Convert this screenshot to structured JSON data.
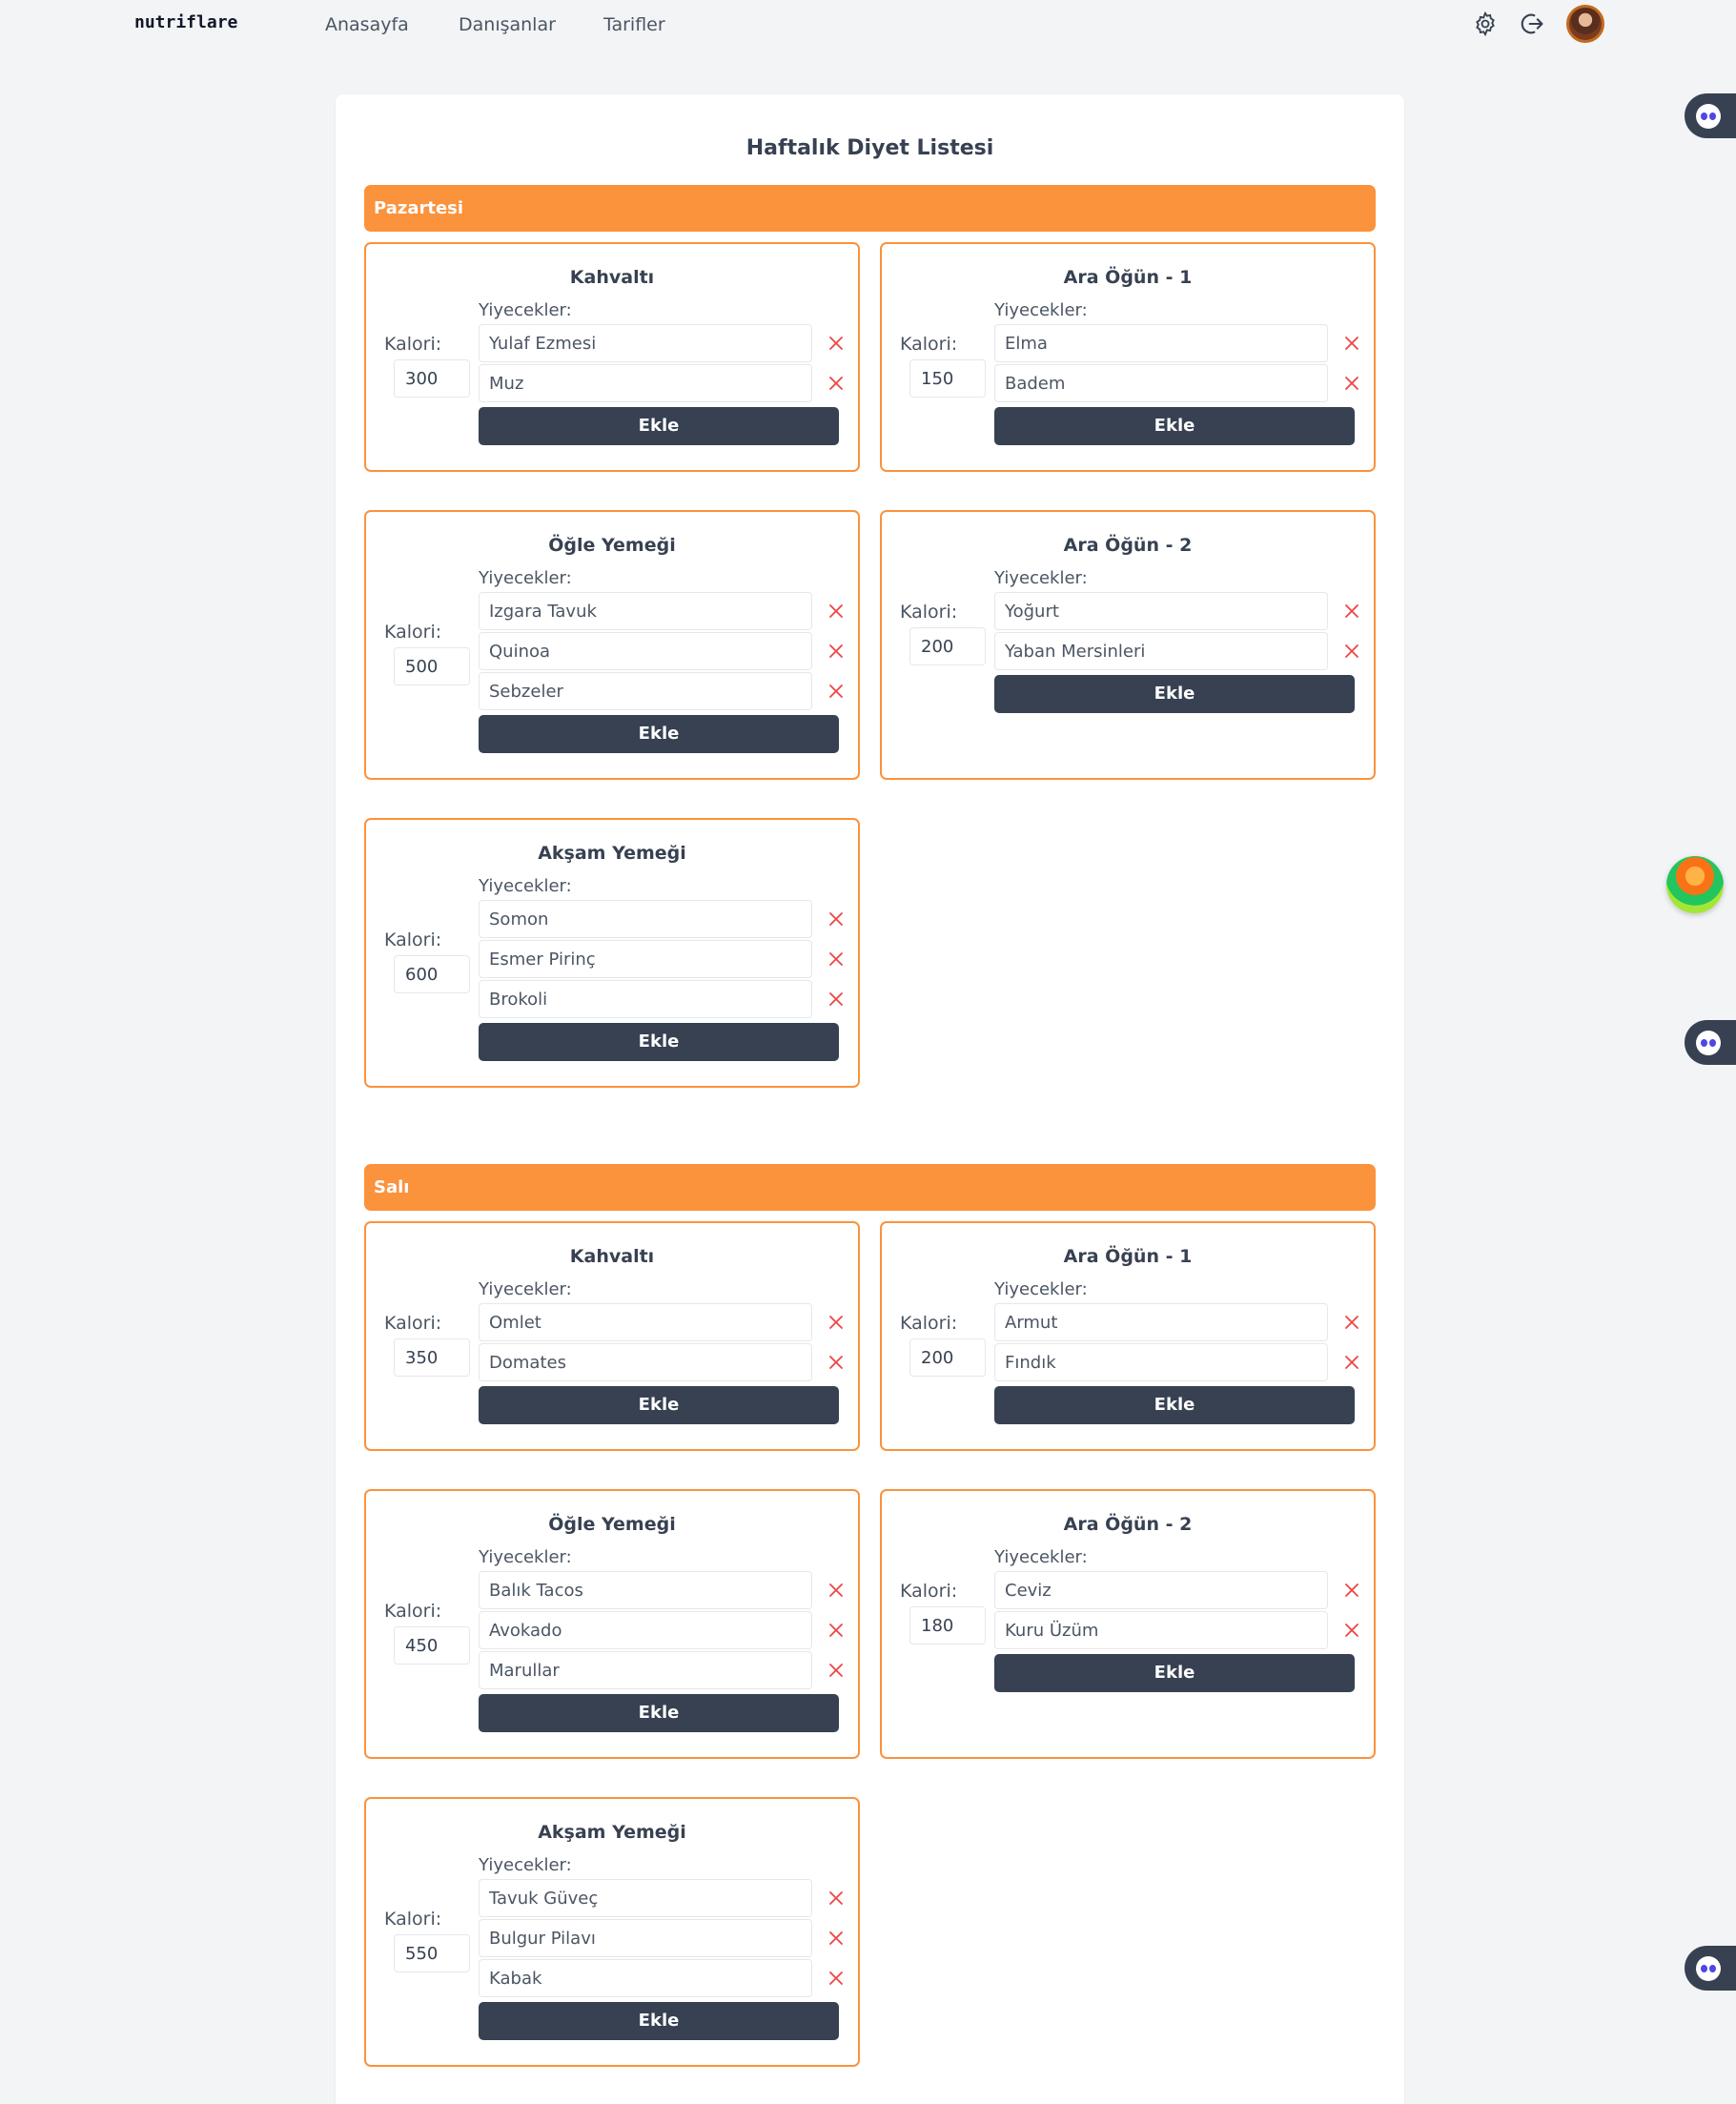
{
  "brand": "nutriflare",
  "nav": {
    "home": "Anasayfa",
    "clients": "Danışanlar",
    "recipes": "Tarifler"
  },
  "page_title": "Haftalık Diyet Listesi",
  "labels": {
    "foods": "Yiyecekler:",
    "calories": "Kalori:",
    "add": "Ekle"
  },
  "days": [
    {
      "name": "Pazartesi",
      "meals": [
        {
          "title": "Kahvaltı",
          "calories": "300",
          "foods": [
            "Yulaf Ezmesi",
            "Muz"
          ]
        },
        {
          "title": "Ara Öğün - 1",
          "calories": "150",
          "foods": [
            "Elma",
            "Badem"
          ]
        },
        {
          "title": "Öğle Yemeği",
          "calories": "500",
          "foods": [
            "Izgara Tavuk",
            "Quinoa",
            "Sebzeler"
          ]
        },
        {
          "title": "Ara Öğün - 2",
          "calories": "200",
          "foods": [
            "Yoğurt",
            "Yaban Mersinleri"
          ]
        },
        {
          "title": "Akşam Yemeği",
          "calories": "600",
          "foods": [
            "Somon",
            "Esmer Pirinç",
            "Brokoli"
          ]
        }
      ]
    },
    {
      "name": "Salı",
      "meals": [
        {
          "title": "Kahvaltı",
          "calories": "350",
          "foods": [
            "Omlet",
            "Domates"
          ]
        },
        {
          "title": "Ara Öğün - 1",
          "calories": "200",
          "foods": [
            "Armut",
            "Fındık"
          ]
        },
        {
          "title": "Öğle Yemeği",
          "calories": "450",
          "foods": [
            "Balık Tacos",
            "Avokado",
            "Marullar"
          ]
        },
        {
          "title": "Ara Öğün - 2",
          "calories": "180",
          "foods": [
            "Ceviz",
            "Kuru Üzüm"
          ]
        },
        {
          "title": "Akşam Yemeği",
          "calories": "550",
          "foods": [
            "Tavuk Güveç",
            "Bulgur Pilavı",
            "Kabak"
          ]
        }
      ]
    }
  ],
  "icons": {
    "settings": "gear-icon",
    "logout": "logout-icon",
    "remove": "close-icon",
    "avatar": "avatar",
    "chat": "chat-bubble-icon",
    "beach": "beach-icon"
  },
  "colors": {
    "accent": "#fb923c",
    "button": "#374151",
    "remove": "#ef4444",
    "background": "#f3f4f6"
  }
}
